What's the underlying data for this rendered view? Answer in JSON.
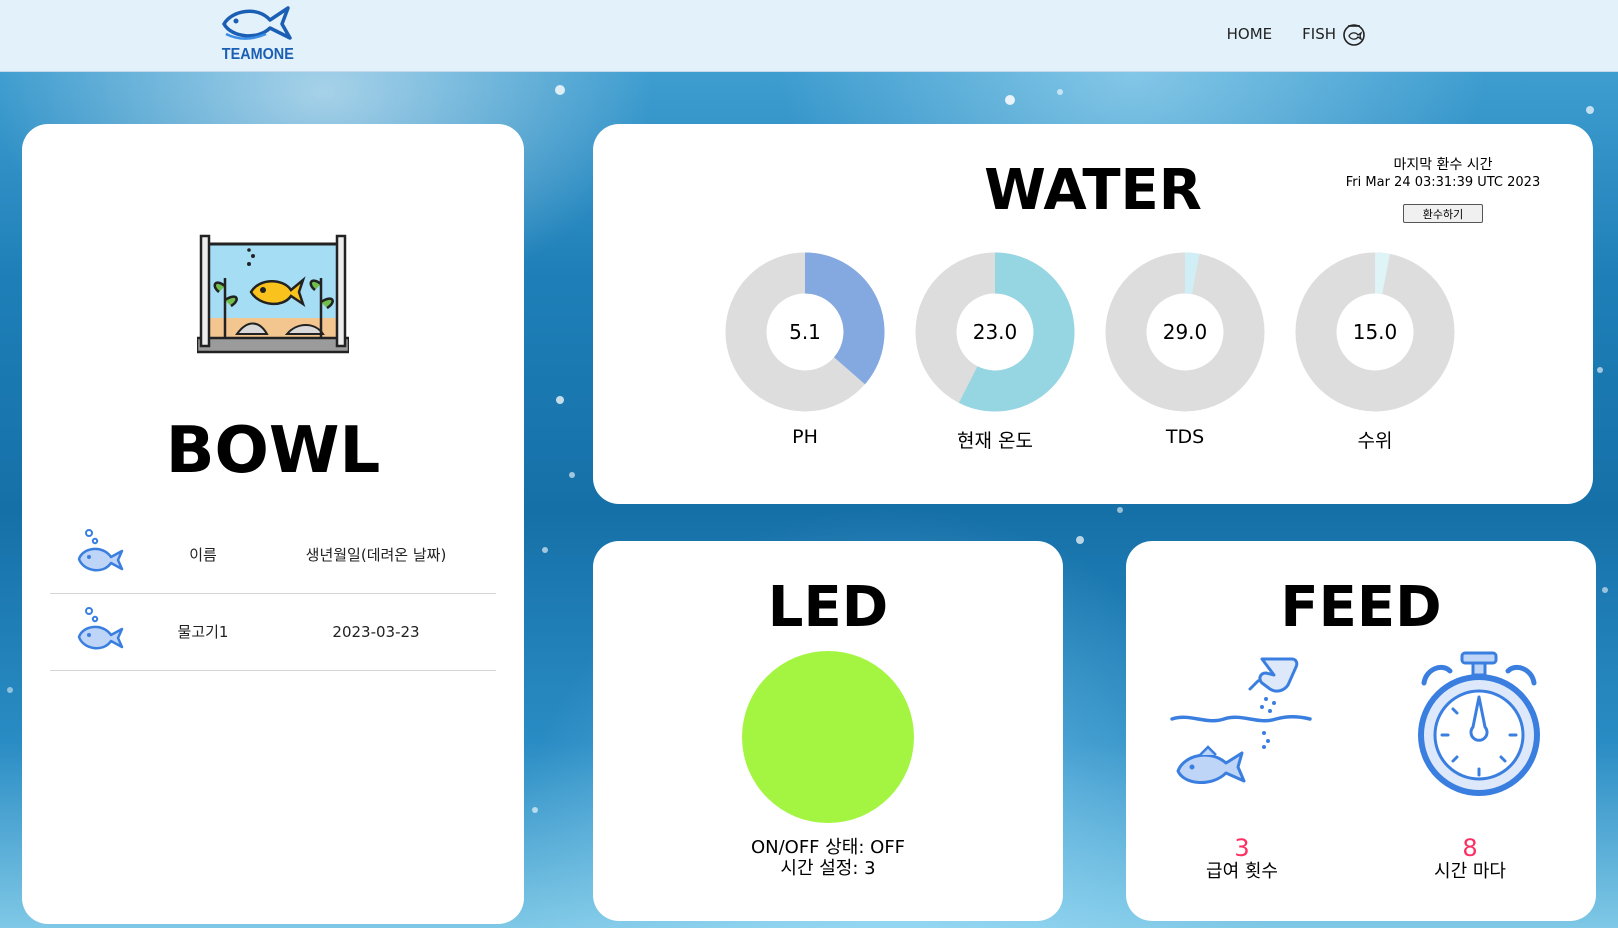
{
  "header": {
    "logo_text": "TEAMONE",
    "nav": [
      {
        "label": "HOME"
      },
      {
        "label": "FISH"
      }
    ]
  },
  "bowl": {
    "title": "BOWL",
    "table": {
      "headers": [
        "이름",
        "생년월일(데려온 날짜)"
      ],
      "rows": [
        {
          "name": "물고기1",
          "date": "2023-03-23"
        }
      ]
    }
  },
  "water": {
    "title": "WATER",
    "last_change_label": "마지막 환수 시간",
    "last_change_time": "Fri Mar 24 03:31:39 UTC 2023",
    "change_button": "환수하기",
    "gauges": [
      {
        "label": "PH",
        "value": "5.1",
        "fraction": 0.364,
        "color": "#84a8e0"
      },
      {
        "label": "현재 온도",
        "value": "23.0",
        "fraction": 0.575,
        "color": "#96d6e3"
      },
      {
        "label": "TDS",
        "value": "29.0",
        "fraction": 0.029,
        "color": "#cfeef5"
      },
      {
        "label": "수위",
        "value": "15.0",
        "fraction": 0.03,
        "color": "#dff4f7"
      }
    ],
    "track_color": "#dddddd"
  },
  "led": {
    "title": "LED",
    "color": "#a3f542",
    "status_line": "ON/OFF 상태: OFF",
    "time_line": "시간 설정: 3"
  },
  "feed": {
    "title": "FEED",
    "count": "3",
    "count_label": "급여 횟수",
    "interval": "8",
    "interval_label": "시간 마다"
  }
}
